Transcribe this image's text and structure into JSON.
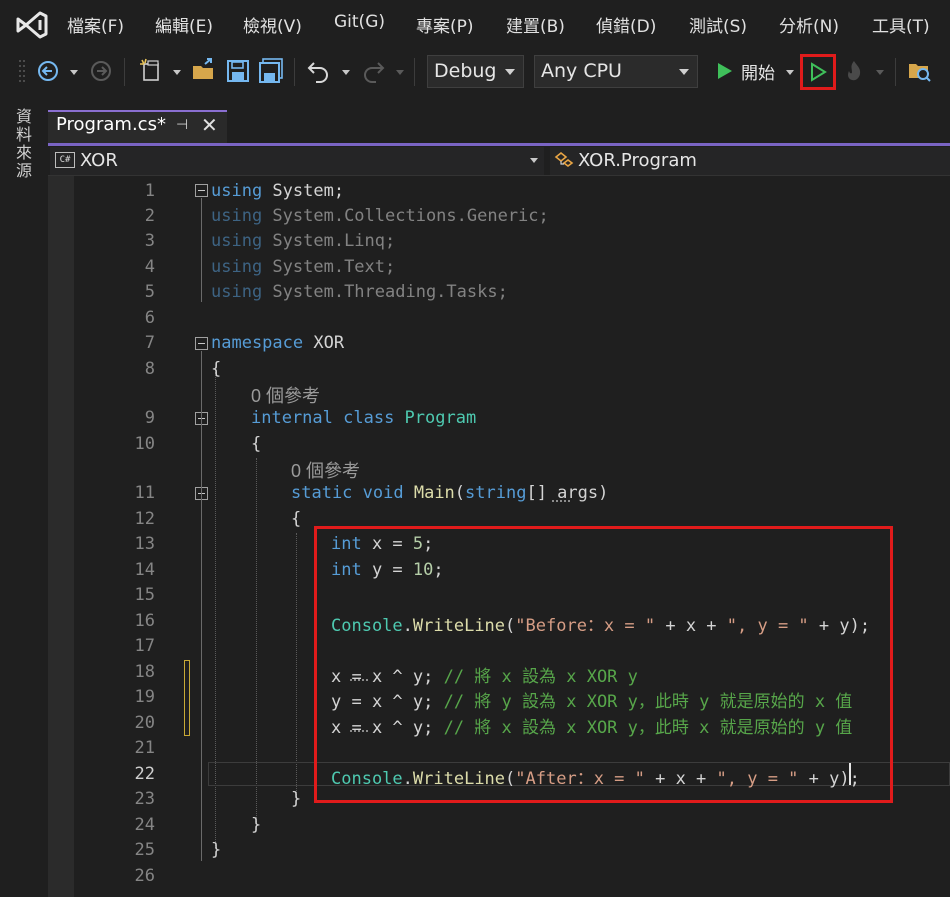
{
  "menu": [
    "檔案(F)",
    "編輯(E)",
    "檢視(V)",
    "Git(G)",
    "專案(P)",
    "建置(B)",
    "偵錯(D)",
    "測試(S)",
    "分析(N)",
    "工具(T)"
  ],
  "toolbar": {
    "config": "Debug",
    "platform": "Any CPU",
    "start_label": "開始"
  },
  "left_rail_tab": "資料來源",
  "tab": {
    "title": "Program.cs*",
    "pin": "⊣",
    "close": "✕"
  },
  "navbar": {
    "cs_badge": "C#",
    "namespace": "XOR",
    "class": "XOR.Program"
  },
  "editor": {
    "line_numbers": [
      "1",
      "2",
      "3",
      "4",
      "5",
      "6",
      "7",
      "8",
      "9",
      "10",
      "11",
      "12",
      "13",
      "14",
      "15",
      "16",
      "17",
      "18",
      "19",
      "20",
      "21",
      "22",
      "23",
      "24",
      "25",
      "26"
    ],
    "references_label_1": "0 個參考",
    "references_label_2": "0 個參考",
    "using1_kw": "using",
    "using1_rest": " System;",
    "using2_kw": "using",
    "using2_rest": " System.Collections.Generic;",
    "using3_kw": "using",
    "using3_rest": " System.Linq;",
    "using4_kw": "using",
    "using4_rest": " System.Text;",
    "using5_kw": "using",
    "using5_rest": " System.Threading.Tasks;",
    "ns_kw": "namespace",
    "ns_name": " XOR",
    "brace_open": "{",
    "brace_close": "}",
    "class_kw1": "internal",
    "class_kw2": " class",
    "class_name": " Program",
    "main_kw1": "static",
    "main_kw2": " void",
    "main_fn": " Main",
    "main_paren": "(",
    "main_type": "string",
    "main_rest": "[] args)",
    "l13_kw": "int",
    "l13_rest": " x = ",
    "l13_num": "5",
    "l13_end": ";",
    "l14_kw": "int",
    "l14_rest": " y = ",
    "l14_num": "10",
    "l14_end": ";",
    "l16_cls": "Console",
    "l16_dot": ".",
    "l16_fn": "WriteLine",
    "l16_p": "(",
    "l16_s1": "\"Before：x = \"",
    "l16_mid": " + x + ",
    "l16_s2": "\", y = \"",
    "l16_end": " + y);",
    "l18_code": "x = x ^ y;",
    "l18_cm": " // 將 x 設為 x XOR y",
    "l19_code": "y = x ^ y;",
    "l19_cm": " // 將 y 設為 x XOR y，此時 y 就是原始的 x 值",
    "l20_code": "x = x ^ y;",
    "l20_cm": " // 將 x 設為 x XOR y，此時 x 就是原始的 y 值",
    "l22_cls": "Console",
    "l22_dot": ".",
    "l22_fn": "WriteLine",
    "l22_p": "(",
    "l22_s1": "\"After：x = \"",
    "l22_mid": " + x + ",
    "l22_s2": "\", y = \"",
    "l22_end": " + y);"
  },
  "colors": {
    "accent": "#8a6fd1",
    "highlight_box": "#e01b1b",
    "keyword": "#569cd6",
    "type": "#4ec9b0",
    "string": "#d69d85",
    "comment": "#57a64a"
  }
}
